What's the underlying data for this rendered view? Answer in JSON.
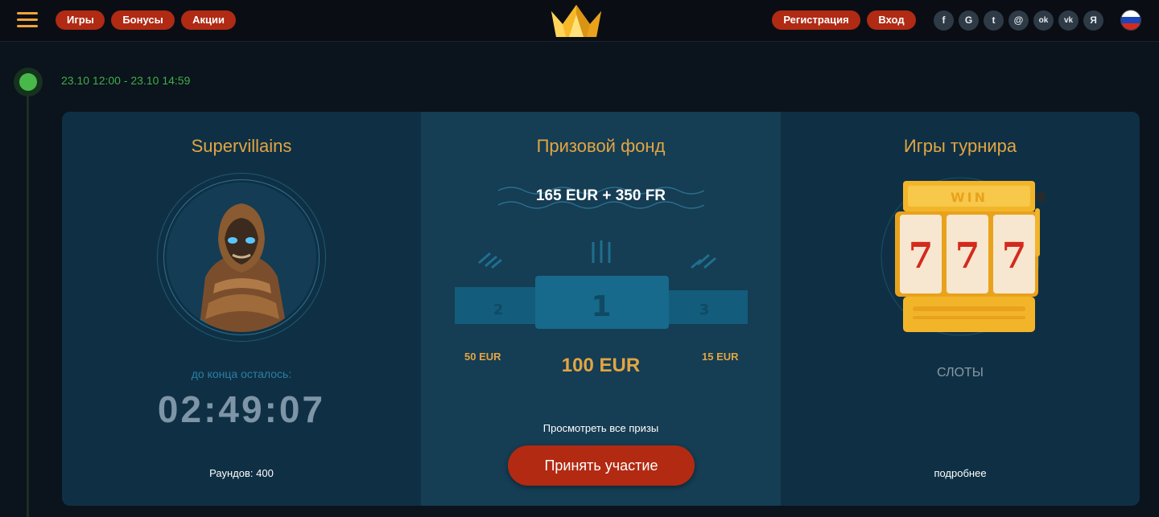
{
  "header": {
    "nav": [
      {
        "label": "Игры"
      },
      {
        "label": "Бонусы"
      },
      {
        "label": "Акции"
      }
    ],
    "register_label": "Регистрация",
    "login_label": "Вход",
    "socials": [
      {
        "icon": "facebook-icon",
        "glyph": "f"
      },
      {
        "icon": "google-icon",
        "glyph": "G"
      },
      {
        "icon": "twitter-icon",
        "glyph": "t"
      },
      {
        "icon": "mail-icon",
        "glyph": "@"
      },
      {
        "icon": "odnoklassniki-icon",
        "glyph": "ok"
      },
      {
        "icon": "vk-icon",
        "glyph": "vk"
      },
      {
        "icon": "yandex-icon",
        "glyph": "Я"
      }
    ],
    "language_flag": "russia-flag-icon"
  },
  "tournament": {
    "dates": "23.10 12:00 - 23.10 14:59",
    "name": "Supervillains",
    "remaining_label": "до конца осталось:",
    "timer": "02:49:07",
    "rounds": "Раундов: 400",
    "prize_title": "Призовой фонд",
    "prize_total": "165 EUR + 350 FR",
    "podium": {
      "first": "1",
      "second": "2",
      "third": "3"
    },
    "prize_first": "100 EUR",
    "prize_second": "50 EUR",
    "prize_third": "15 EUR",
    "all_prizes_label": "Просмотреть все призы",
    "join_label": "Принять участие",
    "games_title": "Игры турнира",
    "slot_sign": "WIN",
    "slot_symbols": "777",
    "games_label": "СЛОТЫ",
    "more_label": "подробнее"
  },
  "colors": {
    "accent": "#e2a544",
    "button": "#b02a14",
    "active_green": "#49b84a"
  }
}
